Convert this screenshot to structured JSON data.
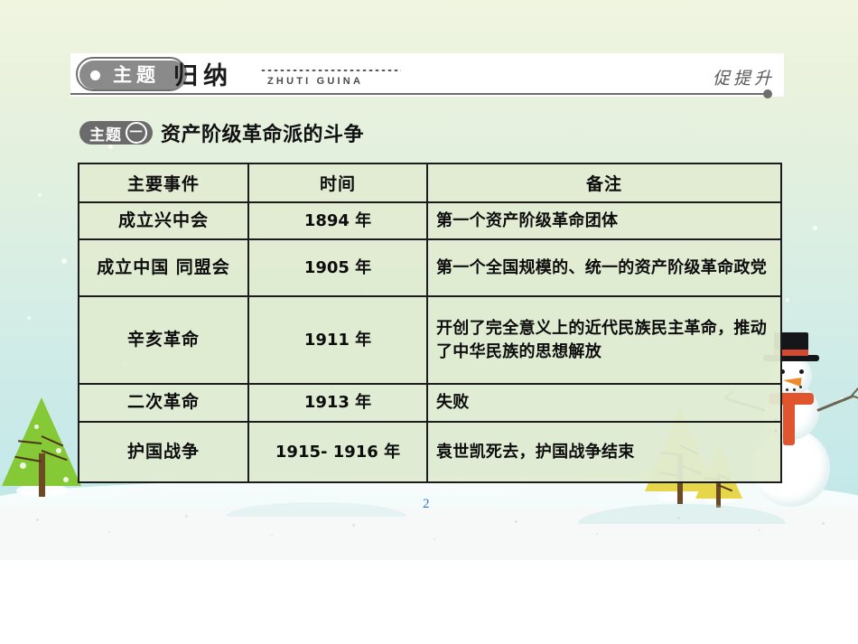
{
  "header": {
    "pill_label": "主题",
    "title_black": "归纳",
    "pinyin": "ZHUTI GUINA",
    "right_note": "促提升"
  },
  "subtitle": {
    "badge_label": "主题",
    "badge_number": "一",
    "text": "资产阶级革命派的斗争"
  },
  "table": {
    "columns": [
      "主要事件",
      "时间",
      "备注"
    ],
    "rows": [
      {
        "event": "成立兴中会",
        "time": "1894 年",
        "remark": "第一个资产阶级革命团体"
      },
      {
        "event": "成立中国\n同盟会",
        "time": "1905 年",
        "remark": "第一个全国规模的、统一的资产阶级革命政党"
      },
      {
        "event": "辛亥革命",
        "time": "1911 年",
        "remark": "开创了完全意义上的近代民族民主革命，推动了中华民族的思想解放"
      },
      {
        "event": "二次革命",
        "time": "1913 年",
        "remark": "失败"
      },
      {
        "event": "护国战争",
        "time": "1915-\n1916 年",
        "remark": "袁世凯死去，护国战争结束"
      }
    ]
  },
  "page_number": "2",
  "colors": {
    "slide_top": "#f0f5e0",
    "slide_bottom": "#c3e8e8",
    "table_fill": "#e1ecd1",
    "table_border": "#1c1c1c",
    "badge_grey": "#6b6b6b",
    "pill_grey": "#8a8a8a",
    "page_number": "#3b6fd4",
    "tree_green": "#86c936",
    "tree_gold": "#e7d64a",
    "snowman_accent": "#e0542e",
    "hat_black": "#15161a"
  },
  "decor": {
    "tree_left": "pine-tree-green",
    "tree_gold_large": "pine-tree-gold",
    "tree_gold_small": "pine-tree-gold-small",
    "snowman": "snowman-with-tophat"
  }
}
